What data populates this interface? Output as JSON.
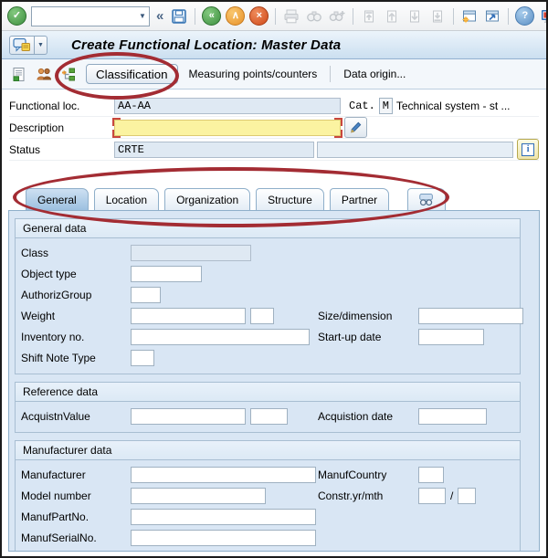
{
  "system_toolbar": {
    "command_field": {
      "value": "",
      "dropdown_glyph": "▼"
    },
    "collapse_glyph": "«",
    "glyphs": {
      "check": "✓",
      "back": "«",
      "up": "∧",
      "cancel": "×",
      "help": "?"
    }
  },
  "title_bar": {
    "title": "Create Functional Location: Master Data",
    "menu_dropdown_glyph": "▼"
  },
  "app_toolbar": {
    "classification_label": "Classification",
    "measuring_label": "Measuring points/counters",
    "data_origin_label": "Data origin..."
  },
  "header_form": {
    "functional_loc_label": "Functional loc.",
    "functional_loc_value": "AA-AA",
    "cat_label": "Cat.",
    "cat_value": "M",
    "cat_text": "Technical system - st ...",
    "description_label": "Description",
    "description_value": "",
    "status_label": "Status",
    "status_value": "CRTE",
    "status_user_value": "",
    "info_glyph": "i"
  },
  "tabs": {
    "items": [
      "General",
      "Location",
      "Organization",
      "Structure",
      "Partner"
    ],
    "active": "General"
  },
  "sections": {
    "general": {
      "title": "General data",
      "fields": {
        "class": {
          "label": "Class",
          "value": ""
        },
        "object_type": {
          "label": "Object type",
          "value": ""
        },
        "authoriz_group": {
          "label": "AuthorizGroup",
          "value": ""
        },
        "weight": {
          "label": "Weight",
          "value": "",
          "unit": ""
        },
        "size_dimension": {
          "label": "Size/dimension",
          "value": ""
        },
        "inventory_no": {
          "label": "Inventory no.",
          "value": ""
        },
        "startup_date": {
          "label": "Start-up date",
          "value": ""
        },
        "shift_note_type": {
          "label": "Shift Note Type",
          "value": ""
        }
      }
    },
    "reference": {
      "title": "Reference data",
      "fields": {
        "acquistn_value": {
          "label": "AcquistnValue",
          "value": "",
          "currency": ""
        },
        "acquistion_date": {
          "label": "Acquistion date",
          "value": ""
        }
      }
    },
    "manufacturer": {
      "title": "Manufacturer data",
      "fields": {
        "manufacturer": {
          "label": "Manufacturer",
          "value": ""
        },
        "manuf_country": {
          "label": "ManufCountry",
          "value": ""
        },
        "model_number": {
          "label": "Model number",
          "value": ""
        },
        "constr_yr_mth": {
          "label": "Constr.yr/mth",
          "year": "",
          "separator": "/",
          "month": ""
        },
        "manuf_part_no": {
          "label": "ManufPartNo.",
          "value": ""
        },
        "manuf_serial_no": {
          "label": "ManufSerialNo.",
          "value": ""
        }
      }
    }
  },
  "annotations": {
    "highlight_color": "#a32c33"
  }
}
